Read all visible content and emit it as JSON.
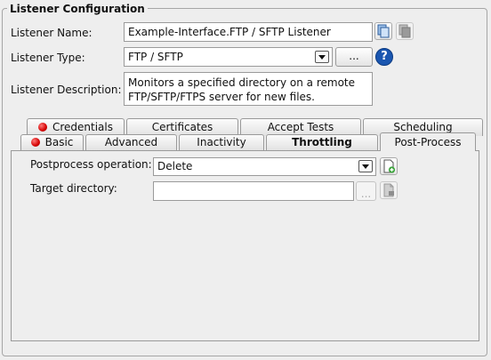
{
  "group": {
    "title": "Listener Configuration"
  },
  "listener": {
    "name_label": "Listener Name:",
    "name_value": "Example-Interface.FTP / SFTP Listener",
    "type_label": "Listener Type:",
    "type_value": "FTP / SFTP",
    "type_browse_label": "...",
    "description_label": "Listener Description:",
    "description_line1": "Monitors a specified directory on a remote",
    "description_line2": "FTP/SFTP/FTPS server for new files.",
    "help_symbol": "?"
  },
  "tabs": {
    "back_row": [
      {
        "label": "Credentials",
        "error": true
      },
      {
        "label": "Certificates",
        "error": false
      },
      {
        "label": "Accept Tests",
        "error": false
      },
      {
        "label": "Scheduling",
        "error": false
      }
    ],
    "front_row": [
      {
        "label": "Basic",
        "error": true
      },
      {
        "label": "Advanced",
        "error": false
      },
      {
        "label": "Inactivity",
        "error": false
      },
      {
        "label": "Throttling",
        "error": false,
        "bold": true
      },
      {
        "label": "Post-Process",
        "error": false,
        "active": true
      }
    ]
  },
  "post_process": {
    "operation_label": "Postprocess operation:",
    "operation_value": "Delete",
    "target_label": "Target directory:",
    "target_value": "",
    "target_browse_label": "..."
  },
  "colors": {
    "error_dot": "#d40000",
    "help_icon": "#1a56b0"
  }
}
